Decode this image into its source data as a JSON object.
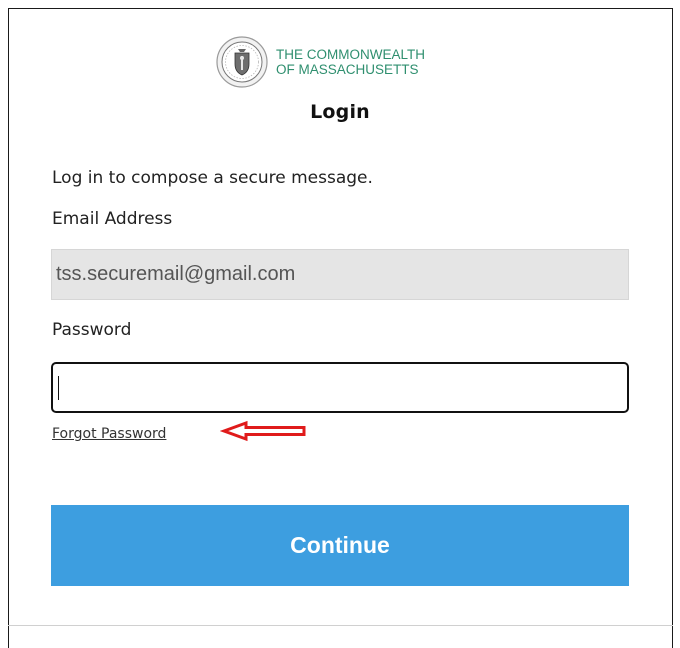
{
  "brand": {
    "line1": "THE COMMONWEALTH",
    "line2": "OF MASSACHUSETTS",
    "color": "#2f8f6f",
    "seal_icon": "massachusetts-seal-icon"
  },
  "page": {
    "title": "Login",
    "intro": "Log in to compose a secure message."
  },
  "form": {
    "email_label": "Email Address",
    "email_value": "tss.securemail@gmail.com",
    "password_label": "Password",
    "password_value": "",
    "forgot_link": "Forgot Password",
    "submit_label": "Continue"
  },
  "annotation": {
    "arrow_icon": "red-arrow-icon",
    "arrow_color": "#e01b1b"
  },
  "colors": {
    "button": "#3d9ee0",
    "readonly_field": "#e5e5e5"
  }
}
